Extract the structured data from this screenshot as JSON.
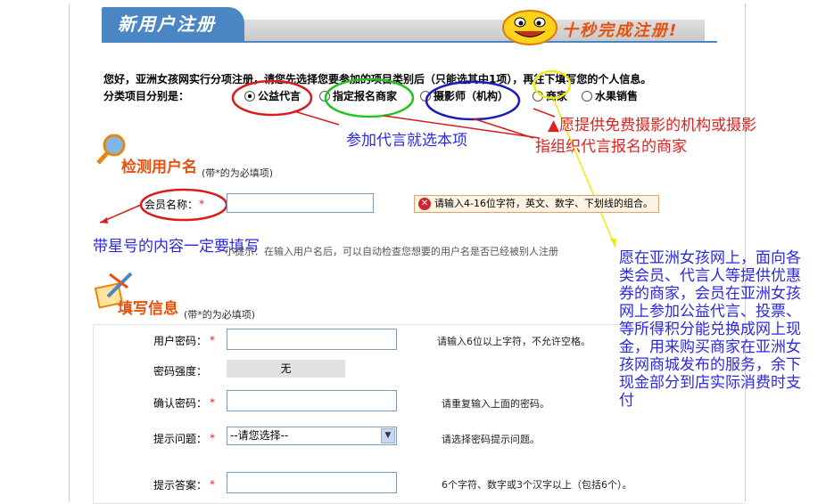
{
  "header": {
    "title": "新用户注册",
    "slogan": "十秒完成注册!"
  },
  "intro": {
    "text": "您好，亚洲女孩网实行分项注册，请您先选择您要参加的项目类别后（只能选其中1项），再往下填写您的个人信息。",
    "categories_label": "分类项目分别是："
  },
  "categories": [
    {
      "label": "公益代言",
      "selected": true
    },
    {
      "label": "指定报名商家",
      "selected": false
    },
    {
      "label": "摄影师（机构）",
      "selected": false
    },
    {
      "label": "商家",
      "selected": false
    },
    {
      "label": "水果销售",
      "selected": false
    }
  ],
  "annotations": {
    "endorse_note": "参加代言就选本项",
    "photo_note_line1": "愿提供免费摄影的机构或摄影",
    "photo_note_line2": "指组织代言报名的商家",
    "required_note": "带星号的内容一定要填写",
    "merchant_note": "愿在亚洲女孩网上，面向各类会员、代言人等提供优惠券的商家，会员在亚洲女孩网上参加公益代言、投票、等所得积分能兑换成网上现金，用来购买商家在亚洲女孩网商城发布的服务，余下现金部分到店实际消费时支付"
  },
  "check_section": {
    "title": "检测用户名",
    "subtitle": "(带*的为必填项)",
    "member_label": "会员名称：",
    "required_mark": "*",
    "member_value": "",
    "error_text": "请输入4-16位字符，英文、数字、下划线的组合。",
    "tip": "小提示：在输入用户名后，可以自动检查您想要的用户名是否已经被别人注册"
  },
  "info_section": {
    "title": "填写信息",
    "subtitle": "(带*的为必填项)",
    "password_label": "用户密码：",
    "password_hint": "请输入6位以上字符，不允许空格。",
    "strength_label": "密码强度：",
    "strength_value": "无",
    "confirm_label": "确认密码：",
    "confirm_hint": "请重复输入上面的密码。",
    "question_label": "提示问题：",
    "question_selected": "--请您选择--",
    "question_hint": "请选择密码提示问题。",
    "answer_label": "提示答案：",
    "answer_hint": "6个字符、数字或3个汉字以上（包括6个）。",
    "required_mark": "*"
  },
  "colors": {
    "accent_blue": "#4b86c4",
    "orange": "#e8500e",
    "annotation_blue": "#2a2ae0",
    "annotation_red": "#e02020"
  }
}
